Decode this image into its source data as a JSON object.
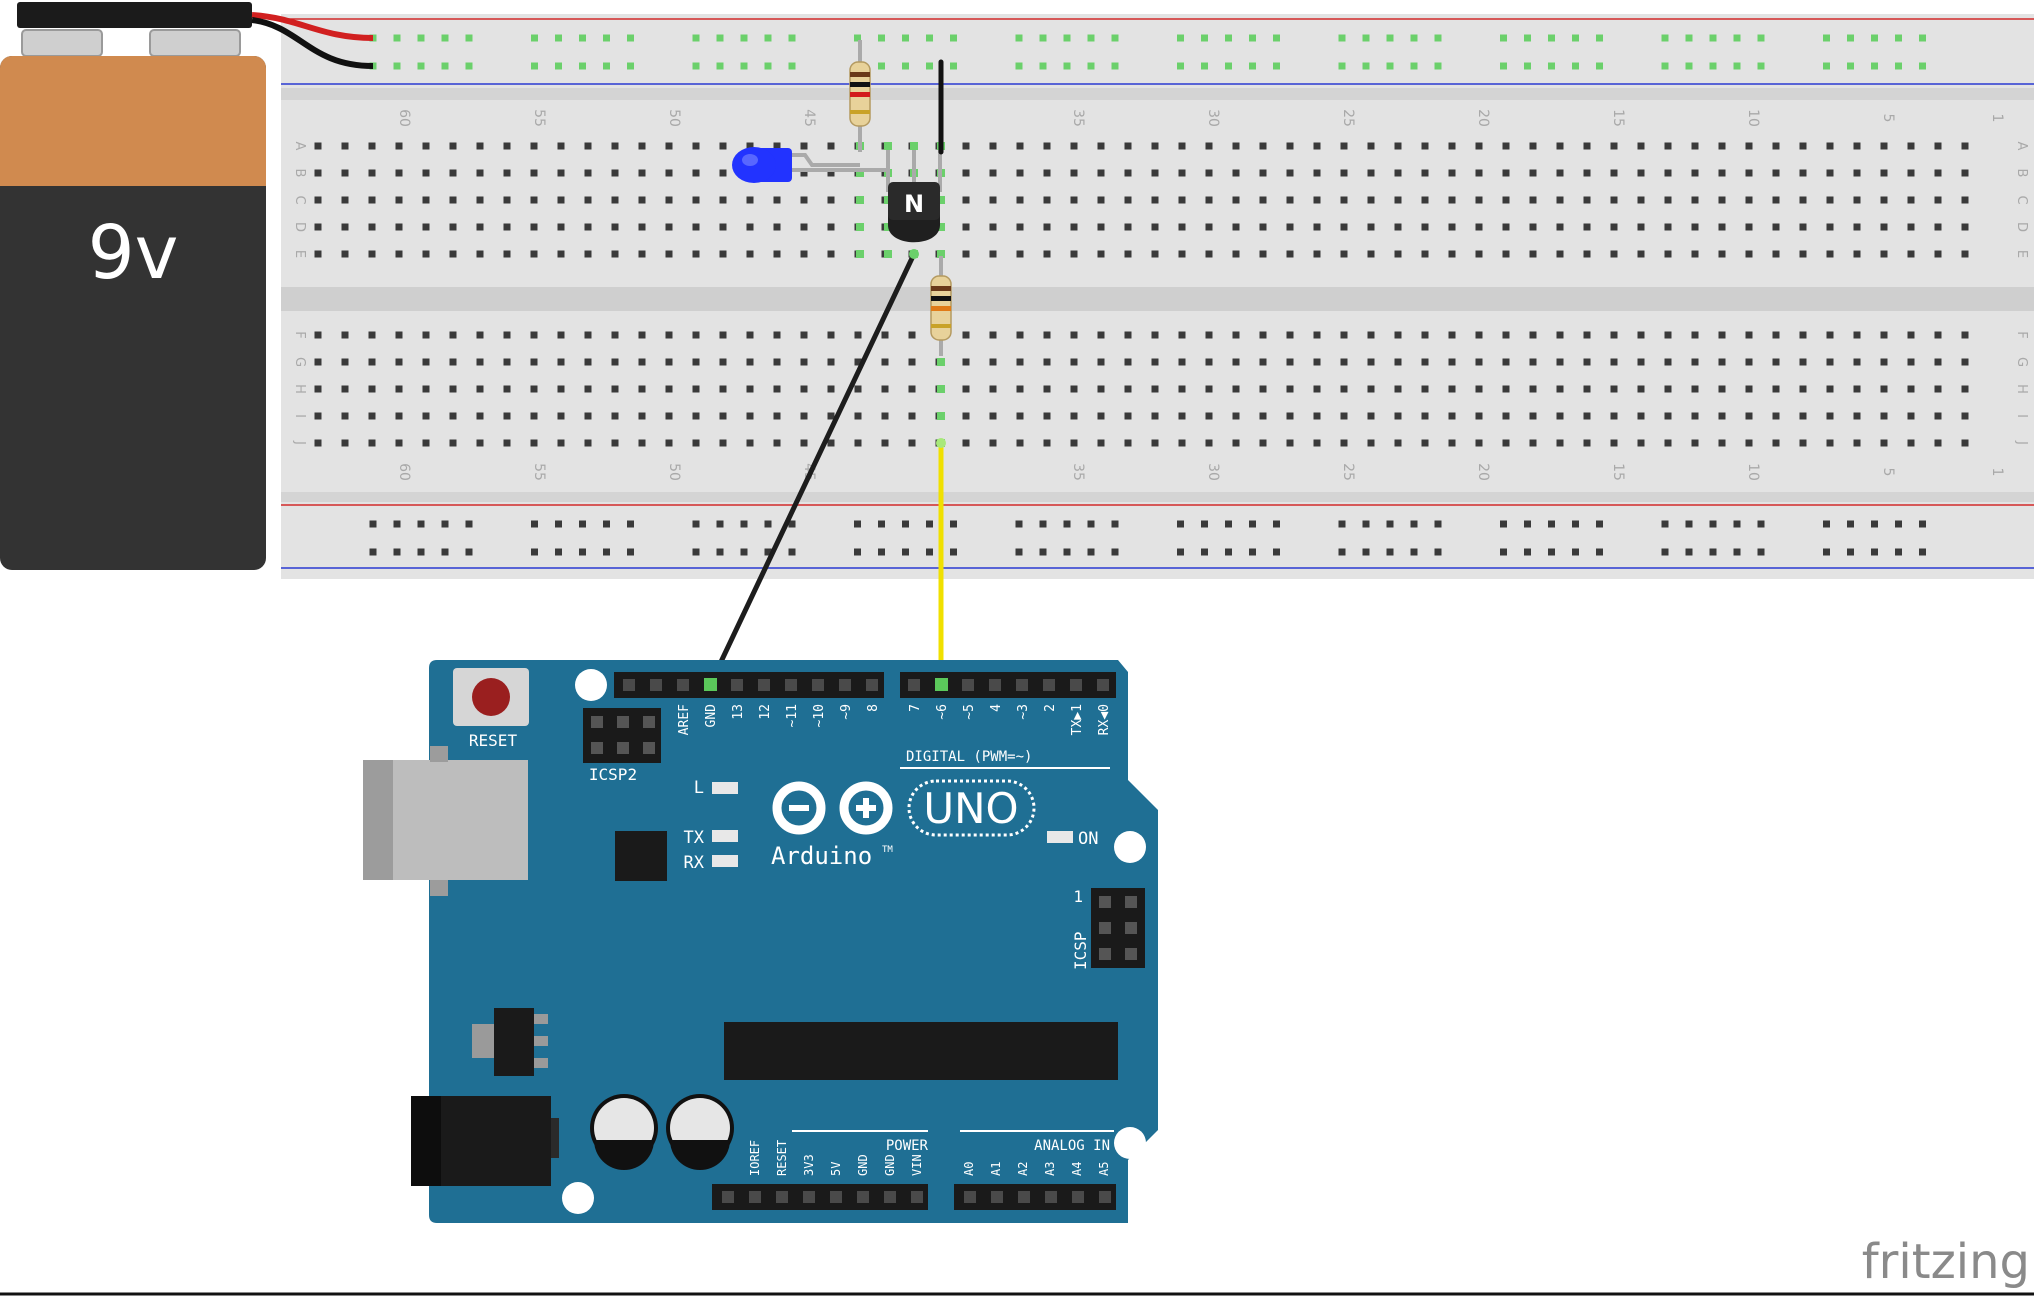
{
  "battery": {
    "label": "9v"
  },
  "breadboard": {
    "column_numbers": [
      "60",
      "55",
      "50",
      "45",
      "35",
      "30",
      "25",
      "20",
      "15",
      "10",
      "5",
      "1"
    ],
    "row_letters_top": [
      "A",
      "B",
      "C",
      "D",
      "E"
    ],
    "row_letters_bottom": [
      "F",
      "G",
      "H",
      "I",
      "J"
    ]
  },
  "transistor": {
    "label": "N"
  },
  "arduino": {
    "reset_label": "RESET",
    "icsp2_label": "ICSP2",
    "icsp_label": "ICSP",
    "icsp_pin1": "1",
    "digital_pins": [
      "AREF",
      "GND",
      "13",
      "12",
      "~11",
      "~10",
      "~9",
      "8",
      "7",
      "~6",
      "~5",
      "4",
      "~3",
      "2",
      "TX▶1",
      "RX◀0"
    ],
    "digital_label": "DIGITAL (PWM=~)",
    "led_l": "L",
    "led_tx": "TX",
    "led_rx": "RX",
    "led_on": "ON",
    "brand": "Arduino",
    "tm": "TM",
    "model": "UNO",
    "power_label": "POWER",
    "analog_label": "ANALOG IN",
    "power_pins": [
      "IOREF",
      "RESET",
      "3V3",
      "5V",
      "GND",
      "GND",
      "VIN"
    ],
    "analog_pins": [
      "A0",
      "A1",
      "A2",
      "A3",
      "A4",
      "A5"
    ]
  },
  "watermark": "fritzing",
  "colors": {
    "board_teal": "#1f6f94",
    "breadboard": "#e3e3e3",
    "rail_red": "#d12b2b",
    "rail_blue": "#2b3bd1",
    "wire_yellow": "#f0e000",
    "wire_black": "#1d1d1d",
    "battery_copper": "#d08a4f",
    "battery_body": "#333333",
    "led_blue": "#2233ff",
    "connected_green": "#6bd06b"
  }
}
